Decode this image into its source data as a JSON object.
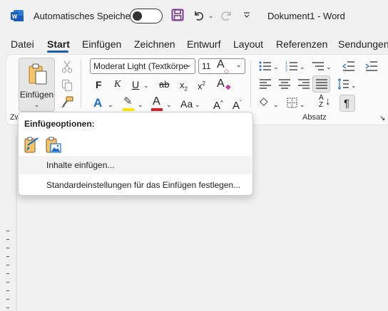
{
  "titlebar": {
    "autosave_label": "Automatisches Speichern",
    "doc_title": "Dokument1  -  Word"
  },
  "tabs": [
    "Datei",
    "Start",
    "Einfügen",
    "Zeichnen",
    "Entwurf",
    "Layout",
    "Referenzen",
    "Sendungen"
  ],
  "active_tab": "Start",
  "ribbon": {
    "paste_label": "Einfügen",
    "clipboard_group_label_partial": "Zw",
    "font_name": "Moderat Light (Textkörpe",
    "font_size": "11",
    "paragraph_group_label": "Absatz"
  },
  "paste_menu": {
    "title": "Einfügeoptionen:",
    "items": [
      "Inhalte einfügen...",
      "Standardeinstellungen für das Einfügen festlegen..."
    ]
  },
  "colors": {
    "accent": "#185abd",
    "word_blue": "#185abd",
    "save_purple": "#7a3b95",
    "highlight_yellow": "#ffe500",
    "font_red": "#d4232a"
  }
}
